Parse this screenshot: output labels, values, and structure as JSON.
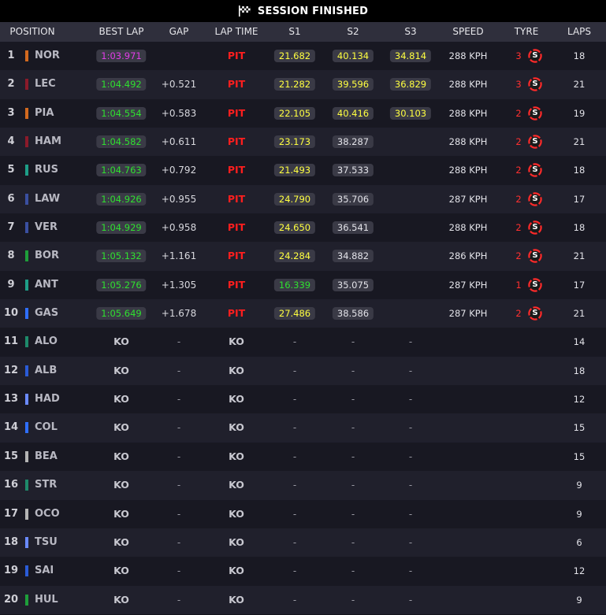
{
  "title": "SESSION FINISHED",
  "columns": {
    "position": "POSITION",
    "best_lap": "BEST LAP",
    "gap": "GAP",
    "lap_time": "LAP TIME",
    "s1": "S1",
    "s2": "S2",
    "s3": "S3",
    "speed": "SPEED",
    "tyre": "TYRE",
    "laps": "LAPS"
  },
  "colors": {
    "mclaren": "#d2691e",
    "ferrari": "#8b1a2a",
    "mercedes": "#1e9e87",
    "williams": "#2a5bd7",
    "redbull": "#3a4fa0",
    "sauber": "#1e9e3a",
    "aston": "#1e8a6a",
    "racingbulls": "#6a8aff",
    "haas": "#b4b4b4",
    "alpine": "#2f6fff",
    "pit": "#ff1e1e",
    "purple": "#e23de8",
    "green": "#2fe02f",
    "yellow": "#ffff40"
  },
  "rows": [
    {
      "pos": "1",
      "driver": "NOR",
      "team": "#d2691e",
      "best": "1:03.971",
      "best_color": "purple",
      "gap": "",
      "lap": "PIT",
      "s1": "21.682",
      "s1c": "yellow",
      "s2": "40.134",
      "s2c": "yellow",
      "s3": "34.814",
      "s3c": "yellow",
      "speed": "288 KPH",
      "tyre_count": "3",
      "tyre": "S",
      "laps": "18"
    },
    {
      "pos": "2",
      "driver": "LEC",
      "team": "#8b1a2a",
      "best": "1:04.492",
      "best_color": "green",
      "gap": "+0.521",
      "lap": "PIT",
      "s1": "21.282",
      "s1c": "yellow",
      "s2": "39.596",
      "s2c": "yellow",
      "s3": "36.829",
      "s3c": "yellow",
      "speed": "288 KPH",
      "tyre_count": "3",
      "tyre": "S",
      "laps": "21"
    },
    {
      "pos": "3",
      "driver": "PIA",
      "team": "#d2691e",
      "best": "1:04.554",
      "best_color": "green",
      "gap": "+0.583",
      "lap": "PIT",
      "s1": "22.105",
      "s1c": "yellow",
      "s2": "40.416",
      "s2c": "yellow",
      "s3": "30.103",
      "s3c": "yellow",
      "speed": "288 KPH",
      "tyre_count": "2",
      "tyre": "S",
      "laps": "19"
    },
    {
      "pos": "4",
      "driver": "HAM",
      "team": "#8b1a2a",
      "best": "1:04.582",
      "best_color": "green",
      "gap": "+0.611",
      "lap": "PIT",
      "s1": "23.173",
      "s1c": "yellow",
      "s2": "38.287",
      "s2c": "white",
      "s3": "",
      "s3c": "",
      "speed": "288 KPH",
      "tyre_count": "2",
      "tyre": "S",
      "laps": "21"
    },
    {
      "pos": "5",
      "driver": "RUS",
      "team": "#1e9e87",
      "best": "1:04.763",
      "best_color": "green",
      "gap": "+0.792",
      "lap": "PIT",
      "s1": "21.493",
      "s1c": "yellow",
      "s2": "37.533",
      "s2c": "white",
      "s3": "",
      "s3c": "",
      "speed": "288 KPH",
      "tyre_count": "2",
      "tyre": "S",
      "laps": "18"
    },
    {
      "pos": "6",
      "driver": "LAW",
      "team": "#3a4fa0",
      "best": "1:04.926",
      "best_color": "green",
      "gap": "+0.955",
      "lap": "PIT",
      "s1": "24.790",
      "s1c": "yellow",
      "s2": "35.706",
      "s2c": "white",
      "s3": "",
      "s3c": "",
      "speed": "287 KPH",
      "tyre_count": "2",
      "tyre": "S",
      "laps": "17"
    },
    {
      "pos": "7",
      "driver": "VER",
      "team": "#3a4fa0",
      "best": "1:04.929",
      "best_color": "green",
      "gap": "+0.958",
      "lap": "PIT",
      "s1": "24.650",
      "s1c": "yellow",
      "s2": "36.541",
      "s2c": "white",
      "s3": "",
      "s3c": "",
      "speed": "288 KPH",
      "tyre_count": "2",
      "tyre": "S",
      "laps": "18"
    },
    {
      "pos": "8",
      "driver": "BOR",
      "team": "#1e9e3a",
      "best": "1:05.132",
      "best_color": "green",
      "gap": "+1.161",
      "lap": "PIT",
      "s1": "24.284",
      "s1c": "yellow",
      "s2": "34.882",
      "s2c": "white",
      "s3": "",
      "s3c": "",
      "speed": "286 KPH",
      "tyre_count": "2",
      "tyre": "S",
      "laps": "21"
    },
    {
      "pos": "9",
      "driver": "ANT",
      "team": "#1e9e87",
      "best": "1:05.276",
      "best_color": "green",
      "gap": "+1.305",
      "lap": "PIT",
      "s1": "16.339",
      "s1c": "green",
      "s2": "35.075",
      "s2c": "white",
      "s3": "",
      "s3c": "",
      "speed": "287 KPH",
      "tyre_count": "1",
      "tyre": "S",
      "laps": "17"
    },
    {
      "pos": "10",
      "driver": "GAS",
      "team": "#2f6fff",
      "best": "1:05.649",
      "best_color": "green",
      "gap": "+1.678",
      "lap": "PIT",
      "s1": "27.486",
      "s1c": "yellow",
      "s2": "38.586",
      "s2c": "white",
      "s3": "",
      "s3c": "",
      "speed": "287 KPH",
      "tyre_count": "2",
      "tyre": "S",
      "laps": "21"
    },
    {
      "pos": "11",
      "driver": "ALO",
      "team": "#1e8a6a",
      "best": "KO",
      "gap": "-",
      "lap": "KO",
      "s1": "-",
      "s2": "-",
      "s3": "-",
      "speed": "",
      "tyre_count": "",
      "tyre": "",
      "laps": "14"
    },
    {
      "pos": "12",
      "driver": "ALB",
      "team": "#2a5bd7",
      "best": "KO",
      "gap": "-",
      "lap": "KO",
      "s1": "-",
      "s2": "-",
      "s3": "-",
      "speed": "",
      "tyre_count": "",
      "tyre": "",
      "laps": "18"
    },
    {
      "pos": "13",
      "driver": "HAD",
      "team": "#6a8aff",
      "best": "KO",
      "gap": "-",
      "lap": "KO",
      "s1": "-",
      "s2": "-",
      "s3": "-",
      "speed": "",
      "tyre_count": "",
      "tyre": "",
      "laps": "12"
    },
    {
      "pos": "14",
      "driver": "COL",
      "team": "#2f6fff",
      "best": "KO",
      "gap": "-",
      "lap": "KO",
      "s1": "-",
      "s2": "-",
      "s3": "-",
      "speed": "",
      "tyre_count": "",
      "tyre": "",
      "laps": "15"
    },
    {
      "pos": "15",
      "driver": "BEA",
      "team": "#b4b4b4",
      "best": "KO",
      "gap": "-",
      "lap": "KO",
      "s1": "-",
      "s2": "-",
      "s3": "-",
      "speed": "",
      "tyre_count": "",
      "tyre": "",
      "laps": "15"
    },
    {
      "pos": "16",
      "driver": "STR",
      "team": "#1e8a6a",
      "best": "KO",
      "gap": "-",
      "lap": "KO",
      "s1": "-",
      "s2": "-",
      "s3": "-",
      "speed": "",
      "tyre_count": "",
      "tyre": "",
      "laps": "9"
    },
    {
      "pos": "17",
      "driver": "OCO",
      "team": "#b4b4b4",
      "best": "KO",
      "gap": "-",
      "lap": "KO",
      "s1": "-",
      "s2": "-",
      "s3": "-",
      "speed": "",
      "tyre_count": "",
      "tyre": "",
      "laps": "9"
    },
    {
      "pos": "18",
      "driver": "TSU",
      "team": "#6a8aff",
      "best": "KO",
      "gap": "-",
      "lap": "KO",
      "s1": "-",
      "s2": "-",
      "s3": "-",
      "speed": "",
      "tyre_count": "",
      "tyre": "",
      "laps": "6"
    },
    {
      "pos": "19",
      "driver": "SAI",
      "team": "#2a5bd7",
      "best": "KO",
      "gap": "-",
      "lap": "KO",
      "s1": "-",
      "s2": "-",
      "s3": "-",
      "speed": "",
      "tyre_count": "",
      "tyre": "",
      "laps": "12"
    },
    {
      "pos": "20",
      "driver": "HUL",
      "team": "#1e9e3a",
      "best": "KO",
      "gap": "-",
      "lap": "KO",
      "s1": "-",
      "s2": "-",
      "s3": "-",
      "speed": "",
      "tyre_count": "",
      "tyre": "",
      "laps": "9"
    }
  ]
}
